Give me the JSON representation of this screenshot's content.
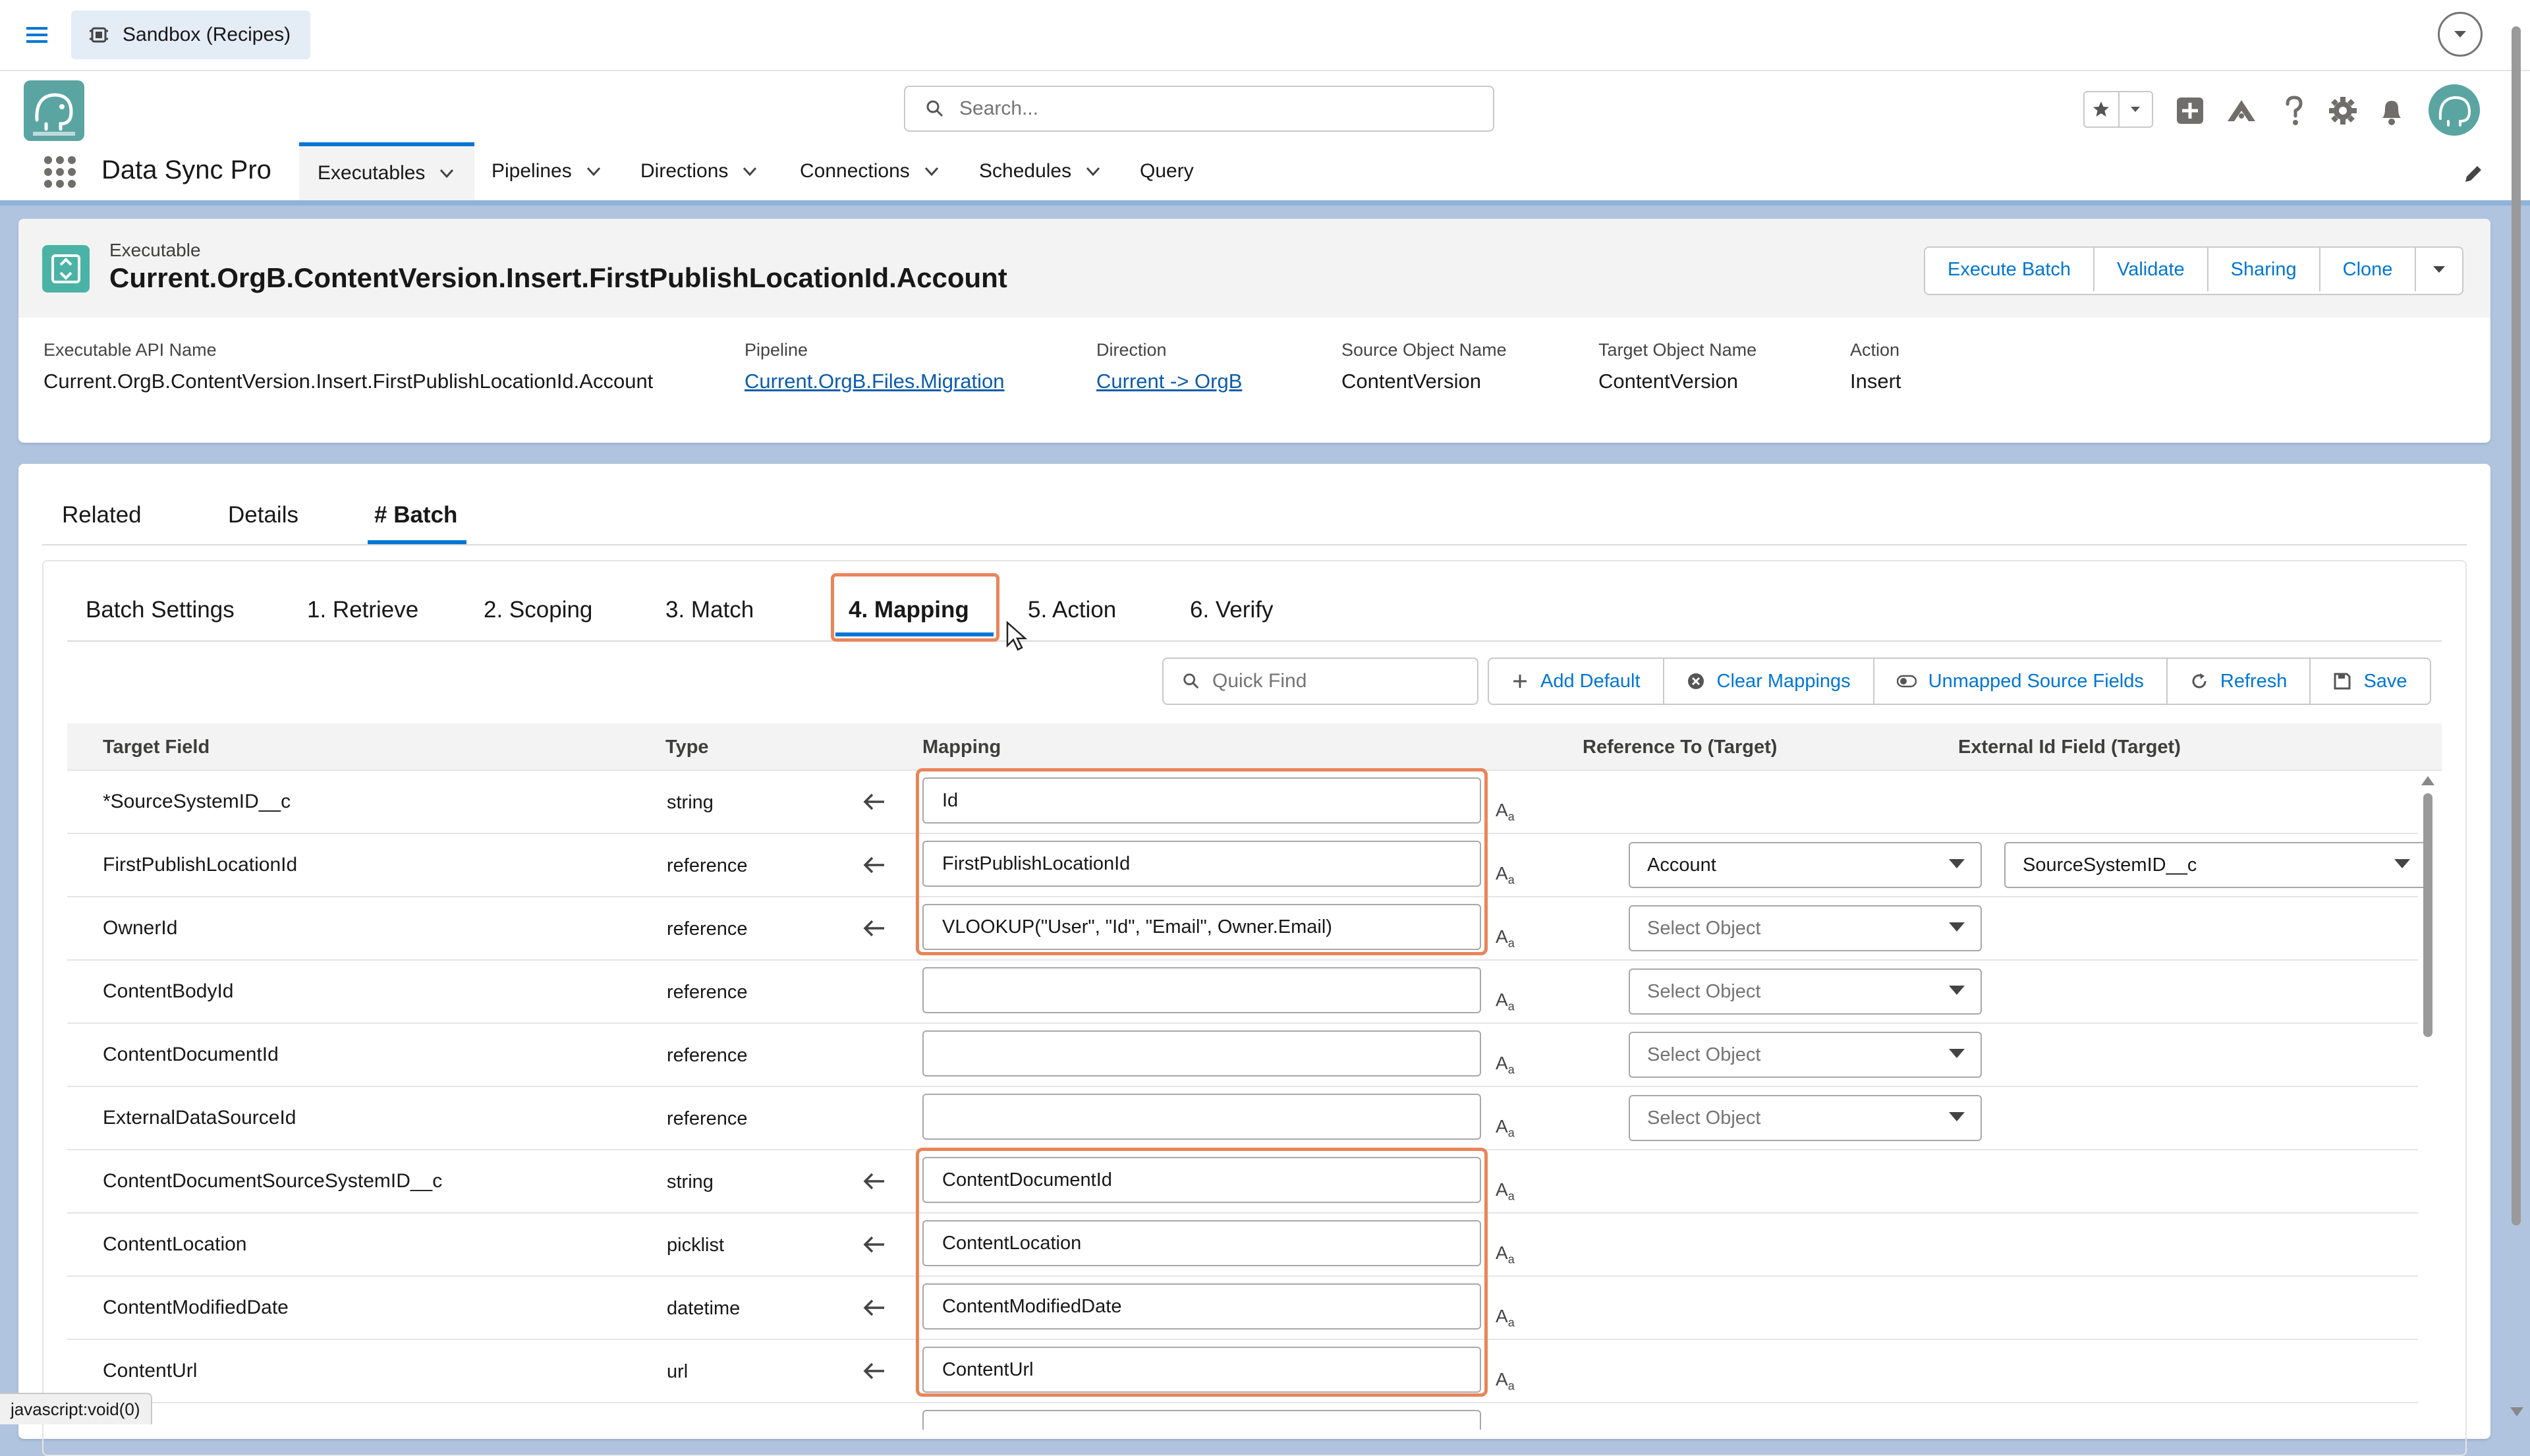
{
  "topbar": {
    "sandbox_label": "Sandbox (Recipes)"
  },
  "header": {
    "search_placeholder": "Search..."
  },
  "app": {
    "name": "Data Sync Pro",
    "nav": [
      {
        "label": "Executables",
        "active": true,
        "dropdown": true
      },
      {
        "label": "Pipelines",
        "dropdown": true
      },
      {
        "label": "Directions",
        "dropdown": true
      },
      {
        "label": "Connections",
        "dropdown": true
      },
      {
        "label": "Schedules",
        "dropdown": true
      },
      {
        "label": "Query",
        "dropdown": false
      }
    ]
  },
  "record": {
    "type": "Executable",
    "title": "Current.OrgB.ContentVersion.Insert.FirstPublishLocationId.Account",
    "actions": [
      "Execute Batch",
      "Validate",
      "Sharing",
      "Clone"
    ],
    "fields": [
      {
        "label": "Executable API Name",
        "value": "Current.OrgB.ContentVersion.Insert.FirstPublishLocationId.Account",
        "link": false
      },
      {
        "label": "Pipeline",
        "value": "Current.OrgB.Files.Migration",
        "link": true
      },
      {
        "label": "Direction",
        "value": "Current -> OrgB",
        "link": true
      },
      {
        "label": "Source Object Name",
        "value": "ContentVersion",
        "link": false
      },
      {
        "label": "Target Object Name",
        "value": "ContentVersion",
        "link": false
      },
      {
        "label": "Action",
        "value": "Insert",
        "link": false
      }
    ]
  },
  "tabs": {
    "related": "Related",
    "details": "Details",
    "batch": "# Batch"
  },
  "sub_tabs": {
    "settings": "Batch Settings",
    "retrieve": "1. Retrieve",
    "scoping": "2. Scoping",
    "match": "3. Match",
    "mapping": "4. Mapping",
    "action": "5. Action",
    "verify": "6. Verify"
  },
  "toolbar": {
    "quick_find_placeholder": "Quick Find",
    "add_default": "Add Default",
    "clear_mappings": "Clear Mappings",
    "unmapped": "Unmapped Source Fields",
    "refresh": "Refresh",
    "save": "Save"
  },
  "table": {
    "headers": {
      "target_field": "Target Field",
      "type": "Type",
      "mapping": "Mapping",
      "reference_to": "Reference To (Target)",
      "external_id": "External Id Field (Target)"
    },
    "rows": [
      {
        "field": "*SourceSystemID__c",
        "type": "string",
        "arrow": true,
        "mapping": "Id"
      },
      {
        "field": "FirstPublishLocationId",
        "type": "reference",
        "arrow": true,
        "mapping": "FirstPublishLocationId",
        "reference": "Account",
        "external_id": "SourceSystemID__c"
      },
      {
        "field": "OwnerId",
        "type": "reference",
        "arrow": true,
        "mapping": "VLOOKUP(\"User\", \"Id\", \"Email\", Owner.Email)",
        "reference_placeholder": "Select Object"
      },
      {
        "field": "ContentBodyId",
        "type": "reference",
        "arrow": false,
        "mapping": "",
        "reference_placeholder": "Select Object"
      },
      {
        "field": "ContentDocumentId",
        "type": "reference",
        "arrow": false,
        "mapping": "",
        "reference_placeholder": "Select Object"
      },
      {
        "field": "ExternalDataSourceId",
        "type": "reference",
        "arrow": false,
        "mapping": "",
        "reference_placeholder": "Select Object"
      },
      {
        "field": "ContentDocumentSourceSystemID__c",
        "type": "string",
        "arrow": true,
        "mapping": "ContentDocumentId"
      },
      {
        "field": "ContentLocation",
        "type": "picklist",
        "arrow": true,
        "mapping": "ContentLocation"
      },
      {
        "field": "ContentModifiedDate",
        "type": "datetime",
        "arrow": true,
        "mapping": "ContentModifiedDate"
      },
      {
        "field": "ContentUrl",
        "type": "url",
        "arrow": true,
        "mapping": "ContentUrl"
      }
    ]
  },
  "status_bar": "javascript:void(0)",
  "colors": {
    "brand_blue": "#0176d3",
    "highlight_orange": "#e8855a",
    "page_bg": "#b0c4df"
  }
}
